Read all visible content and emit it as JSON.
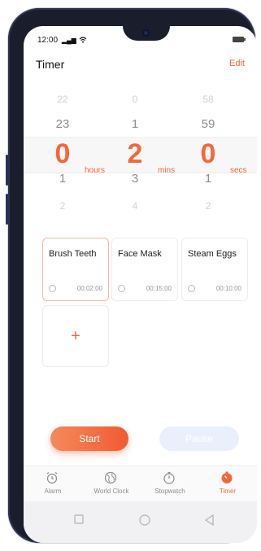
{
  "status": {
    "time": "12:00",
    "signal": "ᵀᴴɪ ◢"
  },
  "header": {
    "title": "Timer",
    "edit_label": "Edit"
  },
  "picker": {
    "hours": {
      "above2": "22",
      "above1": "23",
      "value": "0",
      "below1": "1",
      "below2": "2",
      "unit": "hours"
    },
    "mins": {
      "above2": "0",
      "above1": "1",
      "value": "2",
      "below1": "3",
      "below2": "4",
      "unit": "mins"
    },
    "secs": {
      "above2": "58",
      "above1": "59",
      "value": "0",
      "below1": "1",
      "below2": "2",
      "unit": "secs"
    }
  },
  "presets": [
    {
      "name": "Brush Teeth",
      "time": "00:02:00"
    },
    {
      "name": "Face Mask",
      "time": "00:15:00"
    },
    {
      "name": "Steam Eggs",
      "time": "00:10:00"
    }
  ],
  "add_label": "+",
  "buttons": {
    "start": "Start",
    "pause": "Pause"
  },
  "tabs": [
    {
      "label": "Alarm",
      "icon": "alarm-icon"
    },
    {
      "label": "World Clock",
      "icon": "globe-icon"
    },
    {
      "label": "Stopwatch",
      "icon": "stopwatch-icon"
    },
    {
      "label": "Timer",
      "icon": "timer-icon"
    }
  ],
  "colors": {
    "accent": "#f2683b",
    "inactive": "#8e8e93"
  }
}
